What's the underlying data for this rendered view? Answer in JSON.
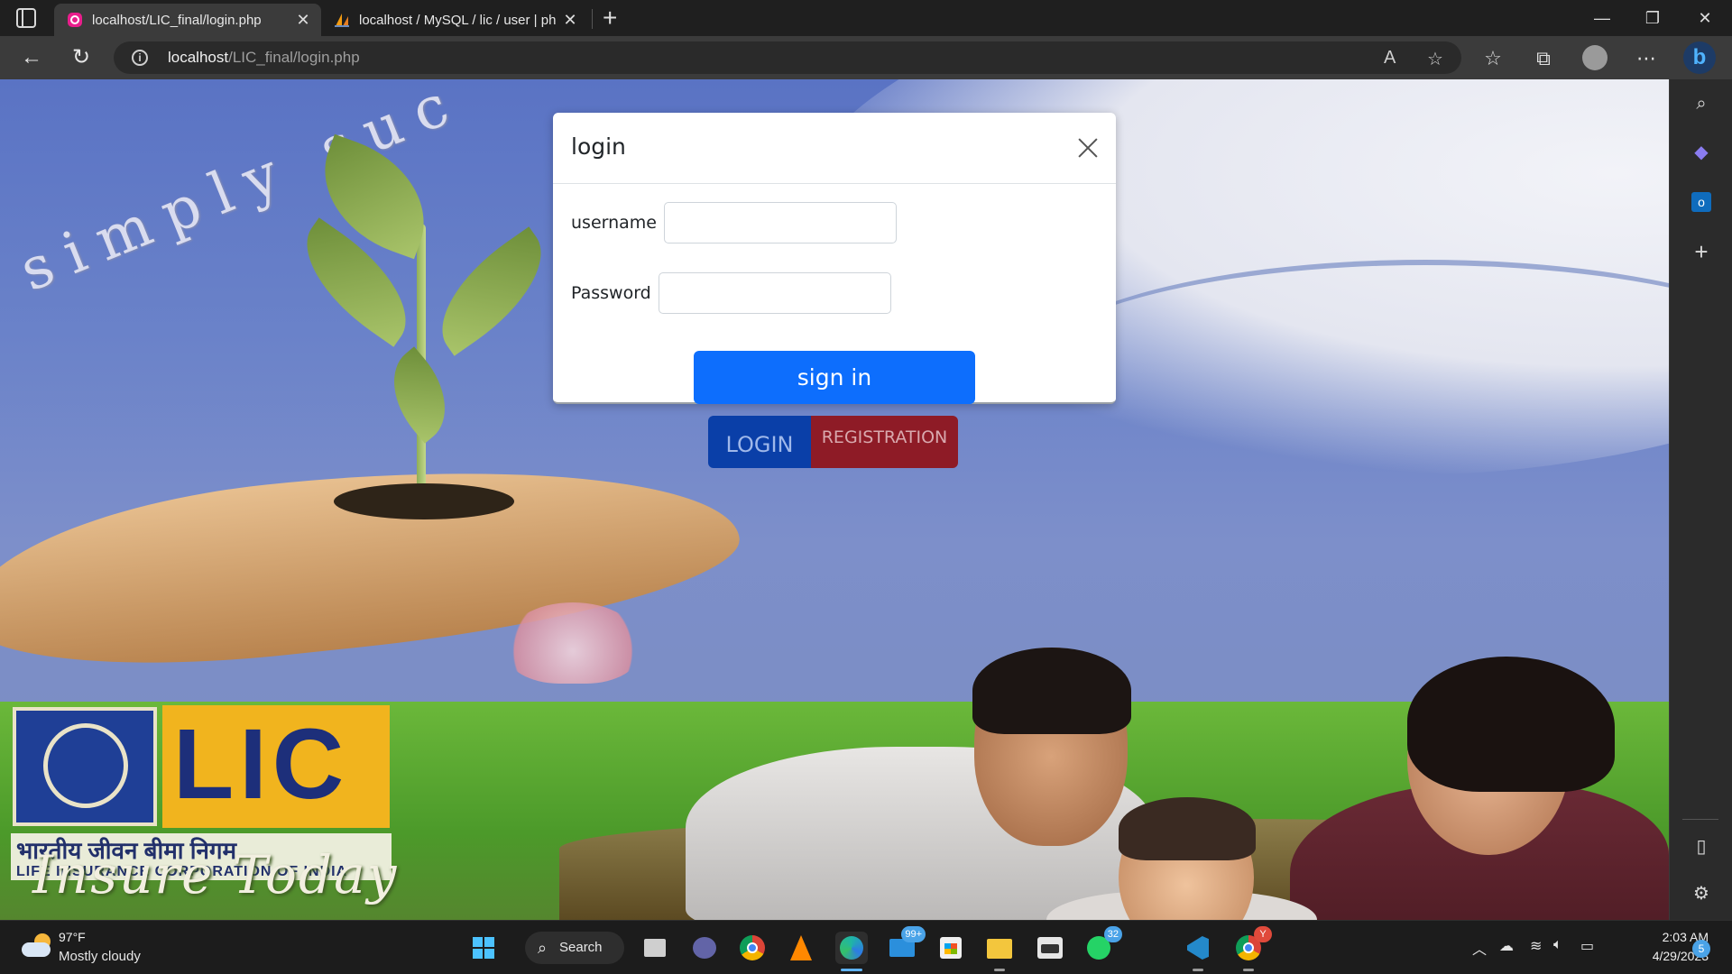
{
  "browser": {
    "tabs": [
      {
        "title": "localhost/LIC_final/login.php",
        "active": true,
        "favicon": "pink-app-icon"
      },
      {
        "title": "localhost / MySQL / lic / user | ph",
        "active": false,
        "favicon": "phpmyadmin-sail-icon"
      }
    ],
    "address": {
      "host": "localhost",
      "path": "/LIC_final/login.php"
    },
    "new_tab_symbol": "+"
  },
  "page": {
    "slogan": "simply suc",
    "brand": {
      "acronym": "LIC",
      "hindi_name": "भारतीय जीवन बीमा निगम",
      "english_name": "LIFE INSURANCE CORPORATION OF INDIA",
      "tagline": "Insure Today"
    },
    "buttons": {
      "login": "LOGIN",
      "registration": "REGISTRATION"
    }
  },
  "modal": {
    "title": "login",
    "fields": {
      "username": {
        "label": "username",
        "value": ""
      },
      "password": {
        "label": "Password",
        "value": ""
      }
    },
    "submit_label": "sign in"
  },
  "colors": {
    "primary": "#0d6efd",
    "login_button": "#0a3fa8",
    "registration_button": "#8e1b26",
    "lic_yellow": "#f1b41e",
    "lic_blue": "#1d2f7a"
  },
  "taskbar": {
    "weather": {
      "temp": "97°F",
      "condition": "Mostly cloudy"
    },
    "search_label": "Search",
    "badges": {
      "mail": "99+",
      "whatsapp": "32",
      "chrome": "Y"
    },
    "clock": {
      "time": "2:03 AM",
      "date": "4/29/2023"
    },
    "notifications": "5"
  }
}
